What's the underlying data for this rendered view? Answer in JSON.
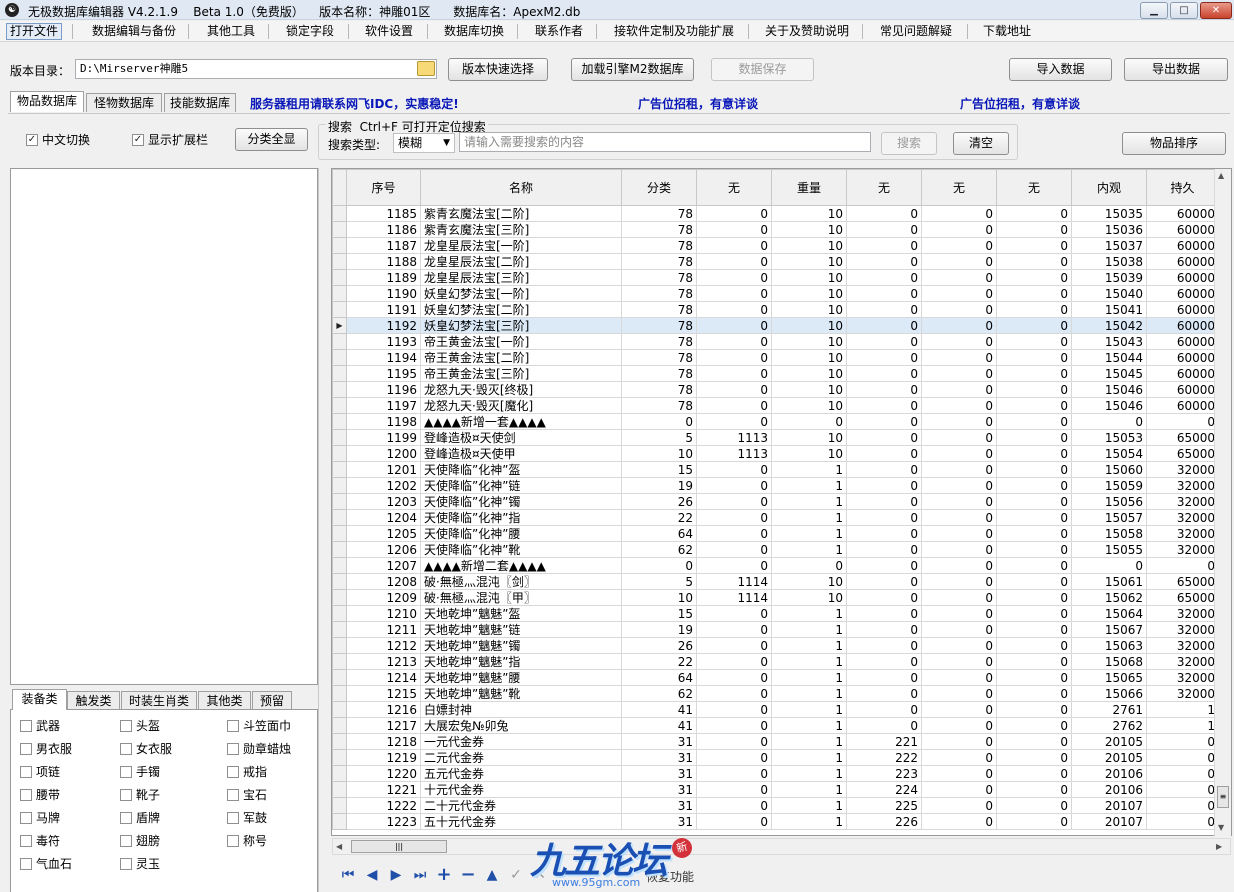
{
  "window": {
    "title": "无极数据库编辑器 V4.2.1.9    Beta 1.0（免费版）    版本名称：神雕01区      数据库名：ApexM2.db"
  },
  "menu": [
    "打开文件",
    "数据编辑与备份",
    "其他工具",
    "锁定字段",
    "软件设置",
    "数据库切换",
    "联系作者",
    "接软件定制及功能扩展",
    "关于及赞助说明",
    "常见问题解疑",
    "下载地址"
  ],
  "toolbar": {
    "dir_label": "版本目录：",
    "dir_value": "D:\\Mirserver神雕5",
    "quick_select": "版本快速选择",
    "load_m2": "加载引擎M2数据库",
    "save": "数据保存",
    "import": "导入数据",
    "export": "导出数据"
  },
  "tabs": [
    "物品数据库",
    "怪物数据库",
    "技能数据库"
  ],
  "ads": [
    "服务器租用请联系网飞IDC，实惠稳定!",
    "广告位招租，有意详谈",
    "广告位招租，有意详谈"
  ],
  "filter": {
    "chinese_toggle": "中文切换",
    "show_ext": "显示扩展栏",
    "expand_all": "分类全显",
    "sort": "物品排序"
  },
  "search": {
    "title": "搜索  Ctrl+F 可打开定位搜索",
    "type_label": "搜索类型:",
    "type_value": "模糊",
    "placeholder": "请输入需要搜索的内容",
    "button": "搜索",
    "clear": "清空"
  },
  "cat_tabs": [
    "装备类",
    "触发类",
    "时装生肖类",
    "其他类",
    "预留"
  ],
  "categories": [
    [
      "武器",
      "头盔",
      "斗笠面巾"
    ],
    [
      "男衣服",
      "女衣服",
      "勋章蜡烛"
    ],
    [
      "项链",
      "手镯",
      "戒指"
    ],
    [
      "腰带",
      "靴子",
      "宝石"
    ],
    [
      "马牌",
      "盾牌",
      "军鼓"
    ],
    [
      "毒符",
      "翅膀",
      "称号"
    ],
    [
      "气血石",
      "灵玉",
      ""
    ]
  ],
  "table": {
    "columns": [
      "序号",
      "名称",
      "分类",
      "无",
      "重量",
      "无",
      "无",
      "无",
      "内观",
      "持久"
    ],
    "selected_row": 7,
    "rows": [
      [
        "1185",
        "紫青玄魔法宝[二阶]",
        "78",
        "0",
        "10",
        "0",
        "0",
        "0",
        "15035",
        "60000"
      ],
      [
        "1186",
        "紫青玄魔法宝[三阶]",
        "78",
        "0",
        "10",
        "0",
        "0",
        "0",
        "15036",
        "60000"
      ],
      [
        "1187",
        "龙皇星辰法宝[一阶]",
        "78",
        "0",
        "10",
        "0",
        "0",
        "0",
        "15037",
        "60000"
      ],
      [
        "1188",
        "龙皇星辰法宝[二阶]",
        "78",
        "0",
        "10",
        "0",
        "0",
        "0",
        "15038",
        "60000"
      ],
      [
        "1189",
        "龙皇星辰法宝[三阶]",
        "78",
        "0",
        "10",
        "0",
        "0",
        "0",
        "15039",
        "60000"
      ],
      [
        "1190",
        "妖皇幻梦法宝[一阶]",
        "78",
        "0",
        "10",
        "0",
        "0",
        "0",
        "15040",
        "60000"
      ],
      [
        "1191",
        "妖皇幻梦法宝[二阶]",
        "78",
        "0",
        "10",
        "0",
        "0",
        "0",
        "15041",
        "60000"
      ],
      [
        "1192",
        "妖皇幻梦法宝[三阶]",
        "78",
        "0",
        "10",
        "0",
        "0",
        "0",
        "15042",
        "60000"
      ],
      [
        "1193",
        "帝王黄金法宝[一阶]",
        "78",
        "0",
        "10",
        "0",
        "0",
        "0",
        "15043",
        "60000"
      ],
      [
        "1194",
        "帝王黄金法宝[二阶]",
        "78",
        "0",
        "10",
        "0",
        "0",
        "0",
        "15044",
        "60000"
      ],
      [
        "1195",
        "帝王黄金法宝[三阶]",
        "78",
        "0",
        "10",
        "0",
        "0",
        "0",
        "15045",
        "60000"
      ],
      [
        "1196",
        "龙怒九天·毁灭[终极]",
        "78",
        "0",
        "10",
        "0",
        "0",
        "0",
        "15046",
        "60000"
      ],
      [
        "1197",
        "龙怒九天·毁灭[魔化]",
        "78",
        "0",
        "10",
        "0",
        "0",
        "0",
        "15046",
        "60000"
      ],
      [
        "1198",
        "▲▲▲▲新增一套▲▲▲▲",
        "0",
        "0",
        "0",
        "0",
        "0",
        "0",
        "0",
        "0"
      ],
      [
        "1199",
        "登峰造极¤天使剑",
        "5",
        "1113",
        "10",
        "0",
        "0",
        "0",
        "15053",
        "65000"
      ],
      [
        "1200",
        "登峰造极¤天使甲",
        "10",
        "1113",
        "10",
        "0",
        "0",
        "0",
        "15054",
        "65000"
      ],
      [
        "1201",
        "天使降临”化神”盔",
        "15",
        "0",
        "1",
        "0",
        "0",
        "0",
        "15060",
        "32000"
      ],
      [
        "1202",
        "天使降临”化神”链",
        "19",
        "0",
        "1",
        "0",
        "0",
        "0",
        "15059",
        "32000"
      ],
      [
        "1203",
        "天使降临”化神”镯",
        "26",
        "0",
        "1",
        "0",
        "0",
        "0",
        "15056",
        "32000"
      ],
      [
        "1204",
        "天使降临”化神”指",
        "22",
        "0",
        "1",
        "0",
        "0",
        "0",
        "15057",
        "32000"
      ],
      [
        "1205",
        "天使降临”化神”腰",
        "64",
        "0",
        "1",
        "0",
        "0",
        "0",
        "15058",
        "32000"
      ],
      [
        "1206",
        "天使降临”化神”靴",
        "62",
        "0",
        "1",
        "0",
        "0",
        "0",
        "15055",
        "32000"
      ],
      [
        "1207",
        "▲▲▲▲新增二套▲▲▲▲",
        "0",
        "0",
        "0",
        "0",
        "0",
        "0",
        "0",
        "0"
      ],
      [
        "1208",
        "破·無極灬混沌〖剑〗",
        "5",
        "1114",
        "10",
        "0",
        "0",
        "0",
        "15061",
        "65000"
      ],
      [
        "1209",
        "破·無極灬混沌〖甲〗",
        "10",
        "1114",
        "10",
        "0",
        "0",
        "0",
        "15062",
        "65000"
      ],
      [
        "1210",
        "天地乾坤”魑魅”盔",
        "15",
        "0",
        "1",
        "0",
        "0",
        "0",
        "15064",
        "32000"
      ],
      [
        "1211",
        "天地乾坤”魑魅”链",
        "19",
        "0",
        "1",
        "0",
        "0",
        "0",
        "15067",
        "32000"
      ],
      [
        "1212",
        "天地乾坤”魑魅”镯",
        "26",
        "0",
        "1",
        "0",
        "0",
        "0",
        "15063",
        "32000"
      ],
      [
        "1213",
        "天地乾坤”魑魅”指",
        "22",
        "0",
        "1",
        "0",
        "0",
        "0",
        "15068",
        "32000"
      ],
      [
        "1214",
        "天地乾坤”魑魅”腰",
        "64",
        "0",
        "1",
        "0",
        "0",
        "0",
        "15065",
        "32000"
      ],
      [
        "1215",
        "天地乾坤”魑魅”靴",
        "62",
        "0",
        "1",
        "0",
        "0",
        "0",
        "15066",
        "32000"
      ],
      [
        "1216",
        "白嫖封神",
        "41",
        "0",
        "1",
        "0",
        "0",
        "0",
        "2761",
        "1"
      ],
      [
        "1217",
        "大展宏兔№卯兔",
        "41",
        "0",
        "1",
        "0",
        "0",
        "0",
        "2762",
        "1"
      ],
      [
        "1218",
        "一元代金券",
        "31",
        "0",
        "1",
        "221",
        "0",
        "0",
        "20105",
        "0"
      ],
      [
        "1219",
        "二元代金券",
        "31",
        "0",
        "1",
        "222",
        "0",
        "0",
        "20105",
        "0"
      ],
      [
        "1220",
        "五元代金券",
        "31",
        "0",
        "1",
        "223",
        "0",
        "0",
        "20106",
        "0"
      ],
      [
        "1221",
        "十元代金券",
        "31",
        "0",
        "1",
        "224",
        "0",
        "0",
        "20106",
        "0"
      ],
      [
        "1222",
        "二十元代金券",
        "31",
        "0",
        "1",
        "225",
        "0",
        "0",
        "20107",
        "0"
      ],
      [
        "1223",
        "五十元代金券",
        "31",
        "0",
        "1",
        "226",
        "0",
        "0",
        "20107",
        "0"
      ]
    ]
  },
  "navigator": {
    "status": "恢复功能"
  },
  "watermark": {
    "url": "www.95gm.com"
  }
}
